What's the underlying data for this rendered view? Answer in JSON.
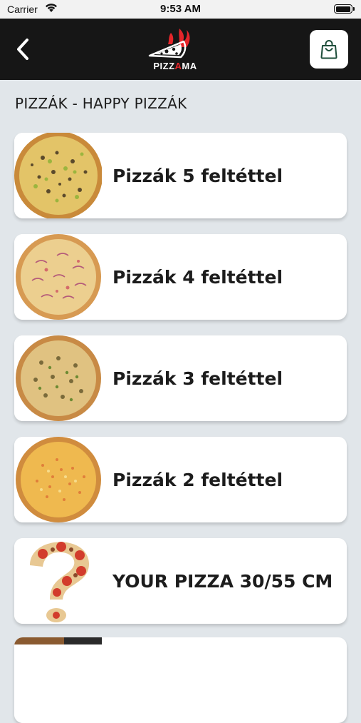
{
  "status_bar": {
    "carrier": "Carrier",
    "time": "9:53 AM"
  },
  "header": {
    "logo_text_1": "PIZZ",
    "logo_text_accent": "A",
    "logo_text_2": "MA",
    "accent_color": "#e5252a"
  },
  "page": {
    "title": "PIZZÁK - HAPPY PIZZÁK"
  },
  "categories": [
    {
      "label": "Pizzák 5 feltéttel",
      "image": "pizza-5-toppings-image"
    },
    {
      "label": "Pizzák 4 feltéttel",
      "image": "pizza-4-toppings-image"
    },
    {
      "label": "Pizzák 3 feltéttel",
      "image": "pizza-3-toppings-image"
    },
    {
      "label": "Pizzák 2 feltéttel",
      "image": "pizza-2-toppings-image"
    },
    {
      "label": "YOUR PIZZA 30/55 CM",
      "image": "custom-pizza-question-mark-image"
    }
  ]
}
